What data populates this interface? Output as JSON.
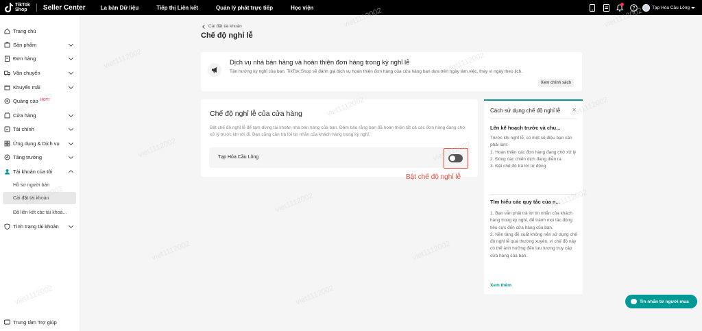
{
  "topbar": {
    "logo_line1": "TikTok",
    "logo_line2": "Shop",
    "brand": "Seller Center",
    "nav": [
      "La bàn Dữ liệu",
      "Tiếp thị Liên kết",
      "Quản lý phát trực tiếp",
      "Học viện"
    ],
    "user_name": "Tạp Hóa Cầu Lông"
  },
  "sidebar": {
    "items": [
      {
        "label": "Trang chủ",
        "icon": "home-icon"
      },
      {
        "label": "Sản phẩm",
        "icon": "product-icon"
      },
      {
        "label": "Đơn hàng",
        "icon": "order-icon"
      },
      {
        "label": "Vận chuyển",
        "icon": "truck-icon"
      },
      {
        "label": "Khuyến mãi",
        "icon": "promo-icon"
      },
      {
        "label": "Quảng cáo",
        "icon": "ads-icon",
        "badge": "HOT!"
      },
      {
        "label": "Cửa hàng",
        "icon": "store-icon"
      },
      {
        "label": "Tài chính",
        "icon": "finance-icon"
      },
      {
        "label": "Ứng dụng & Dịch vụ",
        "icon": "apps-icon"
      },
      {
        "label": "Tăng trưởng",
        "icon": "growth-icon"
      },
      {
        "label": "Tài khoản của tôi",
        "icon": "account-icon"
      }
    ],
    "subitems": [
      "Hồ sơ người bán",
      "Cài đặt tài khoản",
      "Đã liên kết các tài khoả..."
    ],
    "status_item": "Tình trạng tài khoản",
    "help": "Trung tâm Trợ giúp"
  },
  "main": {
    "back_label": "Cài đặt tài khoản",
    "title": "Chế độ nghỉ lễ",
    "notice": {
      "title": "Dịch vụ nhà bán hàng và hoàn thiện đơn hàng trong kỳ nghỉ lễ",
      "desc": "Tận hưởng kỳ nghỉ của bạn. TikTok Shop sẽ đánh giá dịch vụ hoàn thiện đơn hàng của cửa hàng bạn dựa trên ngày làm việc, thay vì ngày theo lịch.",
      "button": "Xem chính sách"
    },
    "store_mode": {
      "title": "Chế độ nghỉ lễ của cửa hàng",
      "desc": "Bật chế độ nghỉ lễ để tạm dừng tài khoản nhà bán hàng của bạn. Đảm bảo rằng bạn đã hoàn thiện tất cả các đơn hàng đang chờ xử lý trước khi rời đi. Bạn cũng cần trả lời tin nhắn của khách hàng trong kỳ nghỉ.",
      "shop_name": "Tạp Hóa Cầu Lông",
      "toggle_on": false,
      "annotation": "Bật chế độ nghỉ lễ"
    }
  },
  "guide": {
    "title": "Cách sử dụng chế độ nghỉ lễ",
    "section1_title": "Lên kế hoạch trước và chu...",
    "section1_body": "Trước khi nghỉ lễ, có một số điều bạn cần phải làm:\n1. Hoàn thiện các đơn hàng đang chờ xử lý\n2. Đóng các chiến dịch đang diễn ra\n3. Đặt chế độ trả lời tự động",
    "section2_title": "Tìm hiểu các quy tắc của n...",
    "section2_body": "1. Bạn vẫn phải trả lời tin nhắn của khách hàng trong kỳ nghỉ, để tránh mọi tác động tiêu cực đến cửa hàng của bạn.\n2. Nền tảng đề xuất không nên sử dụng chế độ nghỉ lễ quá thường xuyên, vì chế độ này có thể ảnh hưởng đến lưu lượng truy cập cửa hàng của bạn.",
    "more": "Xem thêm"
  },
  "chat_button": "Tin nhắn từ người mua",
  "watermark": "viet1112002",
  "colors": {
    "accent": "#009995",
    "brand_red": "#fe2c55",
    "annotation": "#e74c3c"
  }
}
